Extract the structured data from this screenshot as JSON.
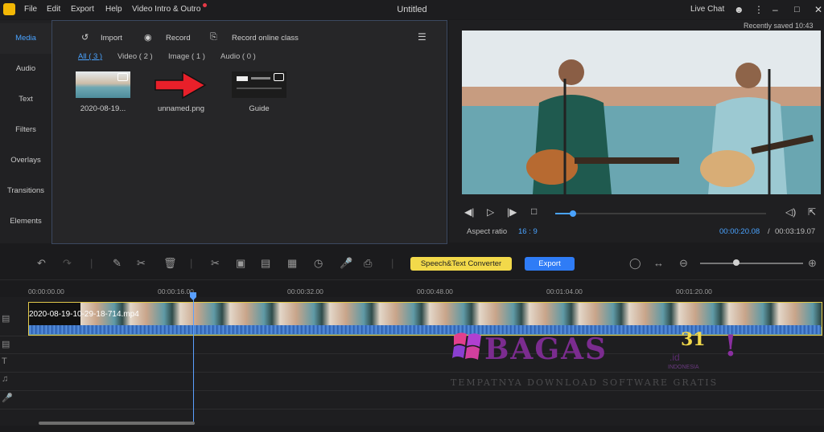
{
  "app": {
    "title": "Untitled",
    "menu": [
      "File",
      "Edit",
      "Export",
      "Help",
      "Video Intro & Outro"
    ],
    "live_chat": "Live Chat",
    "recently_saved": "Recently saved 10:43"
  },
  "sidebar": {
    "items": [
      {
        "label": "Media",
        "active": true
      },
      {
        "label": "Audio",
        "active": false
      },
      {
        "label": "Text",
        "active": false
      },
      {
        "label": "Filters",
        "active": false
      },
      {
        "label": "Overlays",
        "active": false
      },
      {
        "label": "Transitions",
        "active": false
      },
      {
        "label": "Elements",
        "active": false
      }
    ]
  },
  "media": {
    "tools": {
      "import": "Import",
      "record": "Record",
      "record_online": "Record online class"
    },
    "tabs": [
      {
        "label": "All ( 3 )",
        "active": true
      },
      {
        "label": "Video ( 2 )",
        "active": false
      },
      {
        "label": "Image ( 1 )",
        "active": false
      },
      {
        "label": "Audio ( 0 )",
        "active": false
      }
    ],
    "items": [
      {
        "name": "2020-08-19...",
        "icon": "video-thumbnail"
      },
      {
        "name": "unnamed.png",
        "icon": "arrow-image"
      },
      {
        "name": "Guide",
        "icon": "guide-thumbnail"
      }
    ]
  },
  "preview": {
    "aspect_label": "Aspect ratio",
    "aspect_value": "16 : 9",
    "current_time": "00:00:20.08",
    "separator": "/",
    "total_time": "00:03:19.07",
    "progress": 0.085
  },
  "toolbar": {
    "speech_button": "Speech&Text Converter",
    "export_button": "Export",
    "zoom": 0.35
  },
  "timeline": {
    "ticks": [
      "00:00:00.00",
      "00:00:16.00",
      "00:00:32.00",
      "00:00:48.00",
      "00:01:04.00",
      "00:01:20.00"
    ],
    "clip_label": "2020-08-19-10-29-18-714.mp4"
  },
  "watermark": {
    "brand": "BAGAS",
    "number": "31",
    "domain": ".id",
    "country": "INDONESIA",
    "exclaim": "!",
    "tagline": "TEMPATNYA DOWNLOAD SOFTWARE GRATIS"
  },
  "colors": {
    "accent": "#4aa3ff",
    "speech": "#f2d94a",
    "export": "#2f7cf6",
    "clip_border": "#e1c94b"
  }
}
